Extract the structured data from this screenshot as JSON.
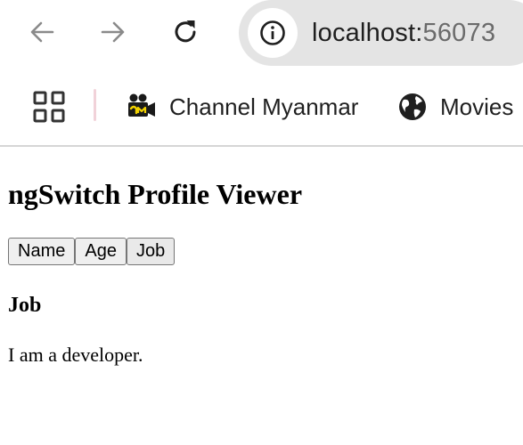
{
  "browser": {
    "url_host": "localhost:",
    "url_port": "56073",
    "bookmarks": [
      {
        "label": "Channel Myanmar",
        "icon": "clapperboard-icon"
      },
      {
        "label": "Movies",
        "icon": "globe-icon"
      }
    ]
  },
  "page": {
    "title": "ngSwitch Profile Viewer",
    "buttons": [
      {
        "label": "Name"
      },
      {
        "label": "Age"
      },
      {
        "label": "Job"
      }
    ],
    "selected": "Job",
    "section_heading": "Job",
    "section_text": "I am a developer."
  }
}
